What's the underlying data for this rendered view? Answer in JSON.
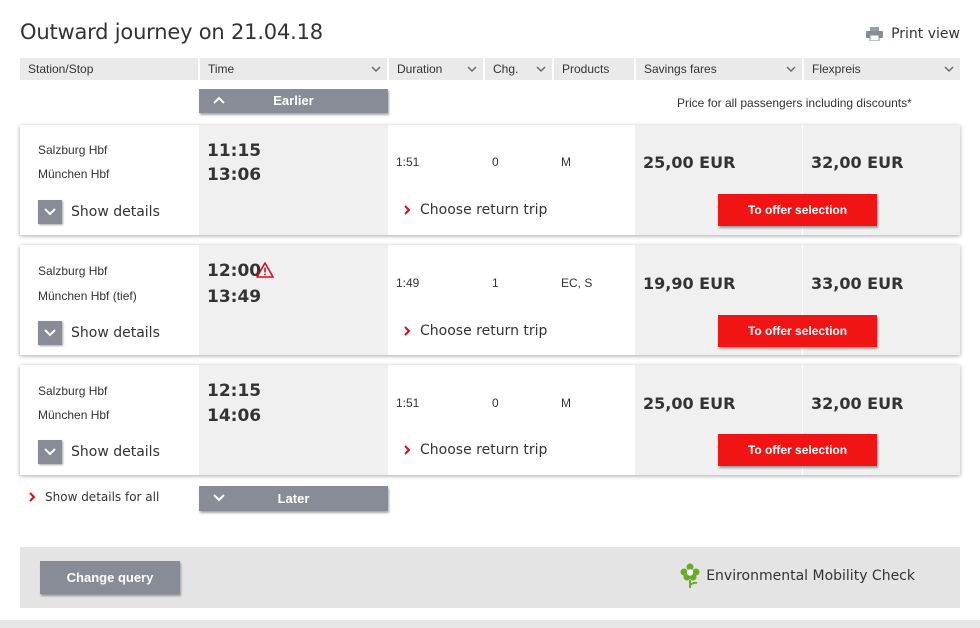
{
  "title": "Outward journey on 21.04.18",
  "print_view": "Print view",
  "columns": {
    "station": "Station/Stop",
    "time": "Time",
    "duration": "Duration",
    "changes": "Chg.",
    "products": "Products",
    "savings": "Savings fares",
    "flex": "Flexpreis"
  },
  "earlier_label": "Earlier",
  "later_label": "Later",
  "price_note": "Price for all passengers including discounts*",
  "connections": [
    {
      "from": "Salzburg Hbf",
      "to": "München Hbf",
      "dep": "11:15",
      "arr": "13:06",
      "duration": "1:51",
      "changes": "0",
      "products": "M",
      "savings_price": "25,00 EUR",
      "flex_price": "32,00 EUR",
      "warning": false
    },
    {
      "from": "Salzburg Hbf",
      "to": "München Hbf (tief)",
      "dep": "12:00",
      "arr": "13:49",
      "duration": "1:49",
      "changes": "1",
      "products": "EC, S",
      "savings_price": "19,90 EUR",
      "flex_price": "33,00 EUR",
      "warning": true
    },
    {
      "from": "Salzburg Hbf",
      "to": "München Hbf",
      "dep": "12:15",
      "arr": "14:06",
      "duration": "1:51",
      "changes": "0",
      "products": "M",
      "savings_price": "25,00 EUR",
      "flex_price": "32,00 EUR",
      "warning": false
    }
  ],
  "show_details_label": "Show details",
  "choose_return_label": "Choose return trip",
  "offer_button_label": "To offer selection",
  "show_details_all": "Show details for all",
  "change_query": "Change query",
  "env_check": "Environmental Mobility Check",
  "colors": {
    "accent_red": "#f01414",
    "button_grey": "#878c96",
    "eco_green": "#6aaa28"
  },
  "icons": {
    "print": "printer-icon",
    "chevron": "chevron-down-icon",
    "arrow": "chevron-right-icon",
    "warning": "warning-icon",
    "eco": "flower-icon"
  }
}
